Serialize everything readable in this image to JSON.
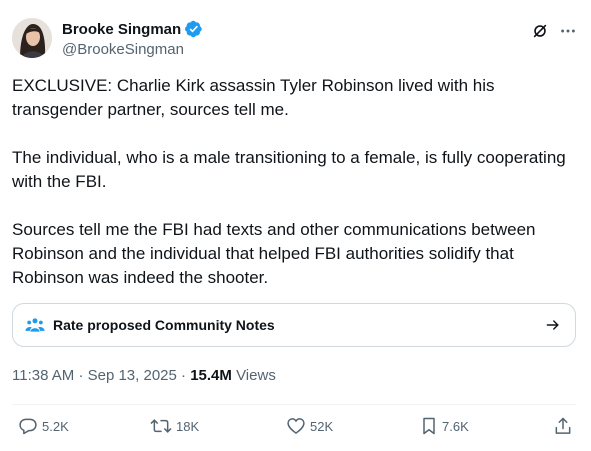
{
  "author": {
    "display_name": "Brooke Singman",
    "handle": "@BrookeSingman",
    "verified": true
  },
  "icons": {
    "grok": "grok-icon",
    "more": "more-icon",
    "community_notes": "community-notes-icon",
    "arrow": "arrow-right-icon",
    "reply": "reply-icon",
    "repost": "repost-icon",
    "like": "like-icon",
    "bookmark": "bookmark-icon",
    "share": "share-icon"
  },
  "tweet": {
    "paragraphs": [
      "EXCLUSIVE: Charlie Kirk assassin Tyler Robinson lived with his transgender partner, sources tell me.",
      "The individual, who is a male transitioning to a female, is fully cooperating with the FBI.",
      "Sources tell me the FBI had texts and other communications between Robinson and the individual that helped FBI authorities solidify that Robinson was indeed the shooter."
    ]
  },
  "community_notes": {
    "label": "Rate proposed Community Notes"
  },
  "meta": {
    "time": "11:38 AM",
    "separator": "·",
    "date": "Sep 13, 2025",
    "views_count": "15.4M",
    "views_label": "Views"
  },
  "actions": {
    "replies": "5.2K",
    "reposts": "18K",
    "likes": "52K",
    "bookmarks": "7.6K"
  },
  "colors": {
    "text": "#0f1419",
    "secondary": "#536471",
    "verified": "#1d9bf0",
    "border": "#cfd9de"
  }
}
